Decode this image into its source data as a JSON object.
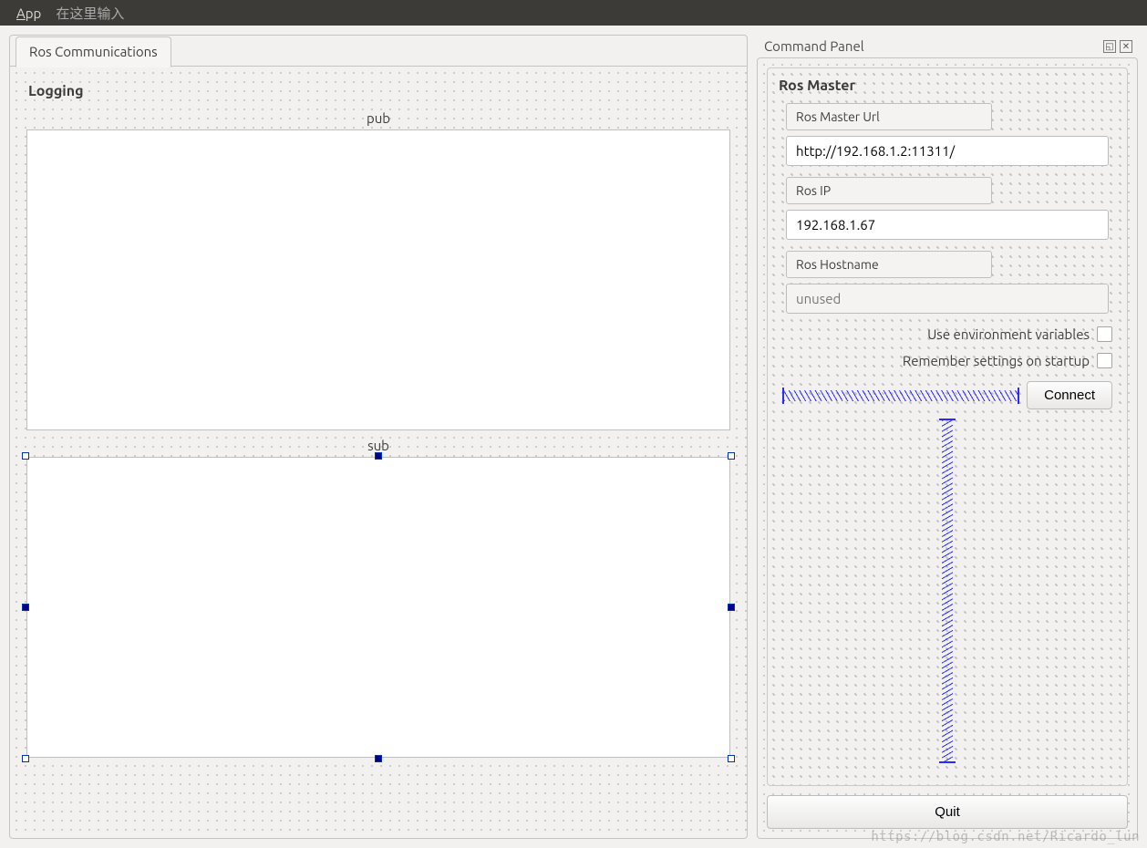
{
  "menu_bar": {
    "app_label": "App",
    "hint": "在这里输入"
  },
  "tabs": {
    "communications_label": "Ros Communications"
  },
  "logging": {
    "title": "Logging",
    "pub_label": "pub",
    "sub_label": "sub"
  },
  "dock": {
    "title": "Command Panel"
  },
  "ros_master": {
    "title": "Ros Master",
    "url_label": "Ros Master Url",
    "url_value": "http://192.168.1.2:11311/",
    "ip_label": "Ros IP",
    "ip_value": "192.168.1.67",
    "hostname_label": "Ros Hostname",
    "hostname_placeholder": "unused",
    "use_env_label": "Use environment variables",
    "remember_label": "Remember settings on startup",
    "connect_label": "Connect"
  },
  "quit_label": "Quit",
  "watermark": "https://blog.csdn.net/Ricardo_lun"
}
